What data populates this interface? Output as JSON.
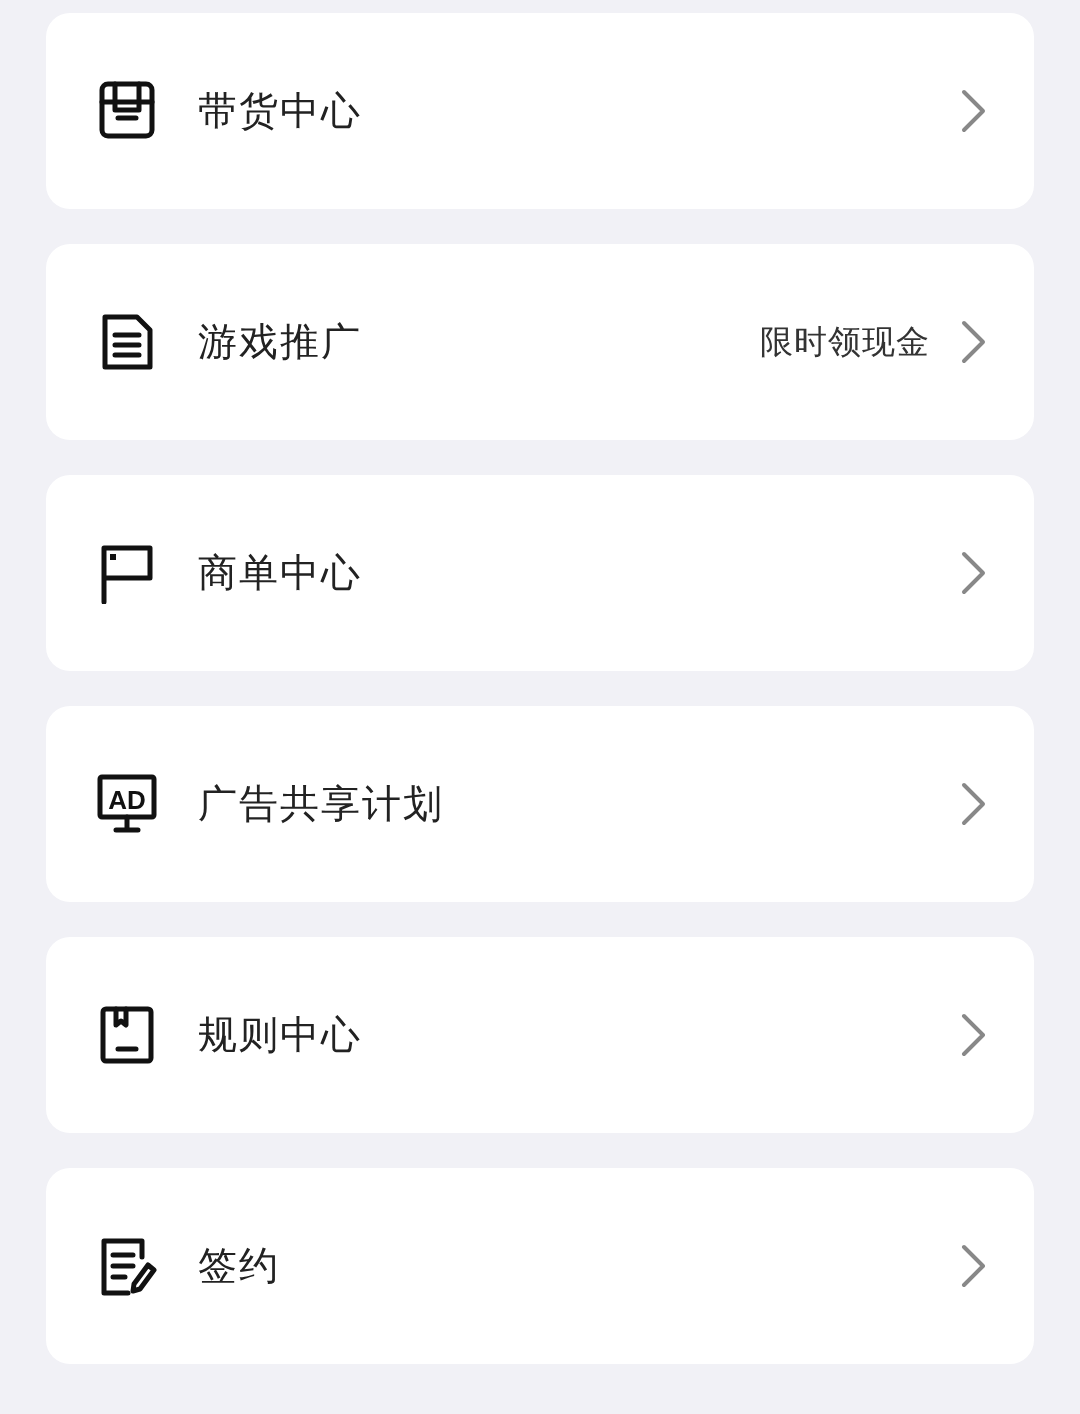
{
  "menu_items": [
    {
      "label": "带货中心"
    },
    {
      "label": "游戏推广",
      "badge": "限时领现金"
    },
    {
      "label": "商单中心"
    },
    {
      "label": "广告共享计划",
      "icon_text": "AD"
    },
    {
      "label": "规则中心"
    },
    {
      "label": "签约"
    }
  ]
}
